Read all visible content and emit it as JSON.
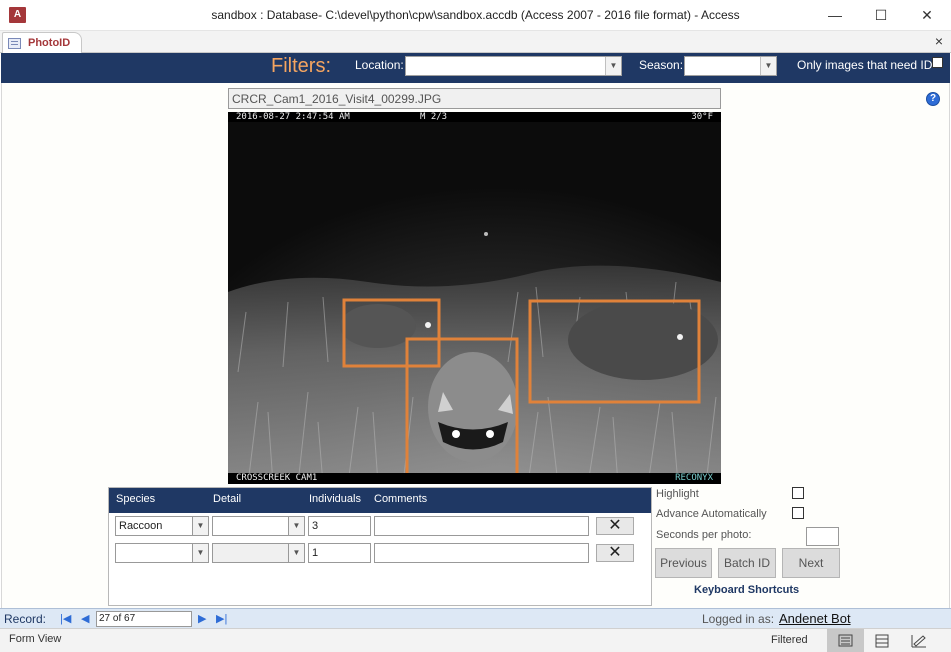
{
  "window": {
    "title": "sandbox : Database- C:\\devel\\python\\cpw\\sandbox.accdb (Access 2007 - 2016 file format) - Access",
    "app_icon_text": "A",
    "minimize_glyph": "—",
    "maximize_glyph": "☐",
    "close_glyph": "✕"
  },
  "tab": {
    "label": "PhotoID",
    "close_glyph": "×"
  },
  "filters": {
    "title": "Filters:",
    "location_label": "Location:",
    "location_value": "",
    "season_label": "Season:",
    "season_value": "",
    "only_need_id_label": "Only images that need ID",
    "only_need_id_checked": false
  },
  "photo": {
    "filename": "CRCR_Cam1_2016_Visit4_00299.JPG",
    "stamp_datetime": "2016-08-27  2:47:54 AM",
    "stamp_mode": "M 2/3",
    "stamp_temp": "30°F",
    "stamp_camera": "CROSSCREEK CAM1",
    "stamp_brand": "RECONYX",
    "box_color": "#e0823a"
  },
  "help_icon": "?",
  "grid": {
    "headers": [
      "Species",
      "Detail",
      "Individuals",
      "Comments"
    ],
    "rows": [
      {
        "species": "Raccoon",
        "detail": "",
        "individuals": "3",
        "comments": "",
        "delete_glyph": "✕"
      },
      {
        "species": "",
        "detail": "",
        "individuals": "1",
        "comments": "",
        "delete_glyph": "✕"
      }
    ]
  },
  "side": {
    "highlight_label": "Highlight",
    "advance_label": "Advance Automatically",
    "seconds_label": "Seconds per photo:",
    "seconds_value": "",
    "previous_label": "Previous",
    "batch_label": "Batch ID",
    "next_label": "Next",
    "shortcuts_label": "Keyboard Shortcuts"
  },
  "record": {
    "label": "Record:",
    "position": "27 of 67",
    "first_glyph": "|◀",
    "prev_glyph": "◀",
    "next_glyph": "▶",
    "last_glyph": "▶|"
  },
  "login": {
    "label": "Logged in as:",
    "user": "Andenet Bot"
  },
  "status": {
    "view": "Form View",
    "filtered": "Filtered"
  },
  "colors": {
    "header_navy": "#1f3864",
    "filters_orange": "#f4a460",
    "access_red": "#a4373a"
  }
}
